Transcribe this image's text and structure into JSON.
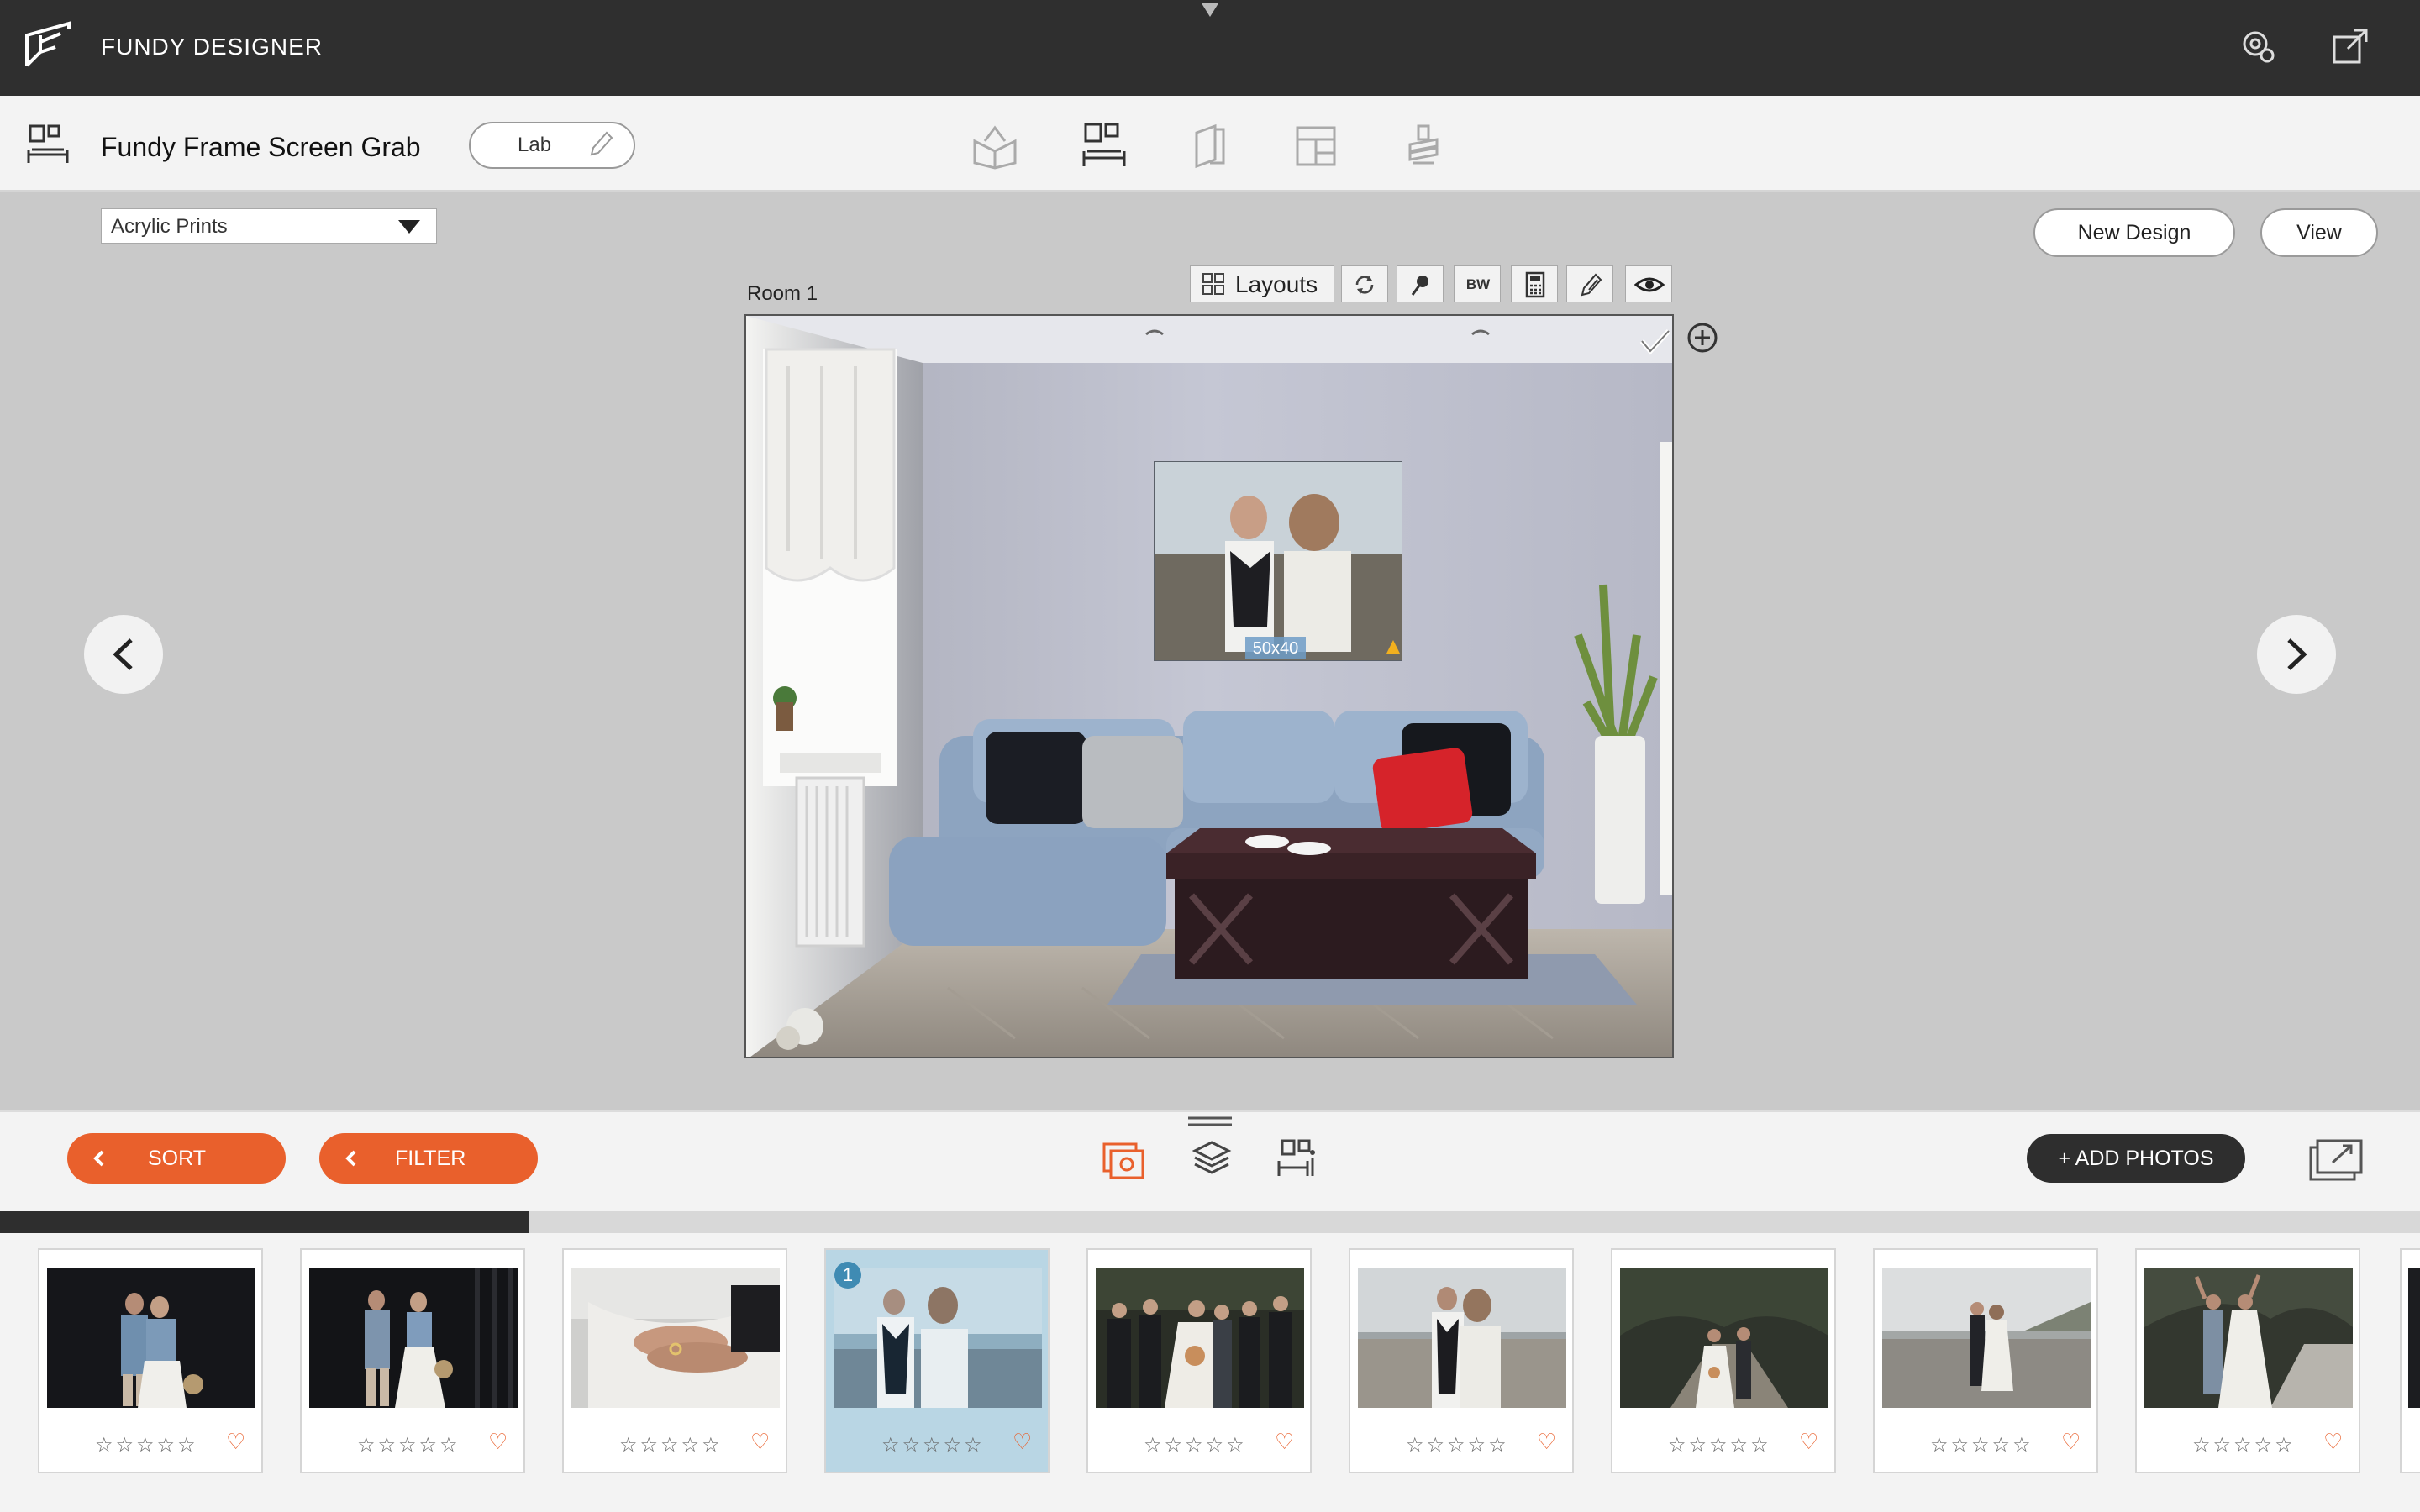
{
  "app": {
    "title": "FUNDY DESIGNER"
  },
  "project": {
    "name": "Fundy Frame Screen Grab",
    "lab_label": "Lab"
  },
  "design": {
    "product_select": "Acrylic Prints",
    "new_design_label": "New Design",
    "view_label": "View",
    "room_label": "Room 1",
    "toolbar": {
      "layouts_label": "Layouts",
      "bw_label": "BW"
    },
    "print_size_label": "50x40"
  },
  "bottom": {
    "sort_label": "SORT",
    "filter_label": "FILTER",
    "add_photos_label": "+ ADD PHOTOS"
  },
  "thumbnails": [
    {
      "rating": "☆☆☆☆☆",
      "heart": "♡",
      "selected": false
    },
    {
      "rating": "☆☆☆☆☆",
      "heart": "♡",
      "selected": false
    },
    {
      "rating": "☆☆☆☆☆",
      "heart": "♡",
      "selected": false
    },
    {
      "rating": "☆☆☆☆☆",
      "heart": "♡",
      "selected": true,
      "badge": "1"
    },
    {
      "rating": "☆☆☆☆☆",
      "heart": "♡",
      "selected": false
    },
    {
      "rating": "☆☆☆☆☆",
      "heart": "♡",
      "selected": false
    },
    {
      "rating": "☆☆☆☆☆",
      "heart": "♡",
      "selected": false
    },
    {
      "rating": "☆☆☆☆☆",
      "heart": "♡",
      "selected": false
    },
    {
      "rating": "☆☆☆☆☆",
      "heart": "♡",
      "selected": false
    }
  ],
  "colors": {
    "accent": "#e9602c",
    "titlebar": "#2f2f2f",
    "selected_thumb": "#b9d6e4"
  },
  "icons": [
    "app-logo-icon",
    "settings-gear-icon",
    "popout-icon",
    "wall-art-icon",
    "album-mode-icon",
    "wall-art-mode-icon",
    "cards-mode-icon",
    "collage-mode-icon",
    "proofing-mode-icon",
    "rotate-icon",
    "pin-icon",
    "calculator-icon",
    "pencil-icon",
    "eye-icon",
    "checkmark-icon",
    "plus-circle-icon",
    "chevron-left-icon",
    "chevron-right-icon",
    "photos-view-icon",
    "layers-view-icon",
    "rooms-view-icon",
    "export-icon"
  ]
}
